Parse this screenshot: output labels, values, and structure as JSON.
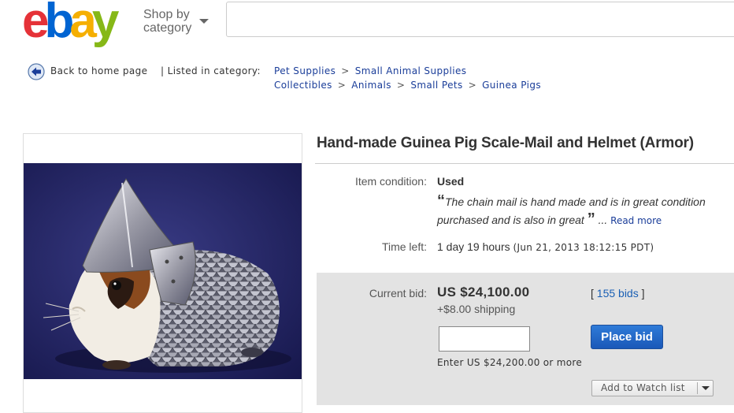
{
  "header": {
    "logo_letters": [
      "e",
      "b",
      "a",
      "y"
    ],
    "logo_colors": [
      "#e53238",
      "#0064d2",
      "#f5af02",
      "#86b817"
    ],
    "shop_by_line1": "Shop by",
    "shop_by_line2": "category",
    "search_value": ""
  },
  "breadcrumb": {
    "back_label": "Back to home page",
    "listed_label": "| Listed in category:",
    "path1": [
      "Pet Supplies",
      "Small Animal Supplies"
    ],
    "path2": [
      "Collectibles",
      "Animals",
      "Small Pets",
      "Guinea Pigs"
    ],
    "separator": ">"
  },
  "item": {
    "title": "Hand-made Guinea Pig Scale-Mail and Helmet (Armor)",
    "condition_label": "Item condition:",
    "condition_value": "Used",
    "description_line1": "The chain mail is hand made and is in great condition",
    "description_line2": "purchased and is also in great",
    "ellipsis": "...",
    "read_more": "Read more",
    "time_label": "Time left:",
    "time_value": "1 day 19 hours",
    "time_date": "(Jun 21, 2013  18:12:15 PDT)"
  },
  "bid": {
    "current_label": "Current bid:",
    "current_value": "US $24,100.00",
    "shipping": "+$8.00 shipping",
    "bids_open": "[",
    "bids_count": "155 bids",
    "bids_close": "]",
    "input_value": "",
    "place_bid_label": "Place bid",
    "enter_hint": "Enter US $24,200.00 or more",
    "watch_label": "Add to Watch list"
  },
  "icons": {
    "back": "back-arrow-icon",
    "caret": "caret-down-icon"
  },
  "colors": {
    "link": "#1a3d99",
    "bid_button": "#1a58b8",
    "panel": "#e3e3e3"
  }
}
